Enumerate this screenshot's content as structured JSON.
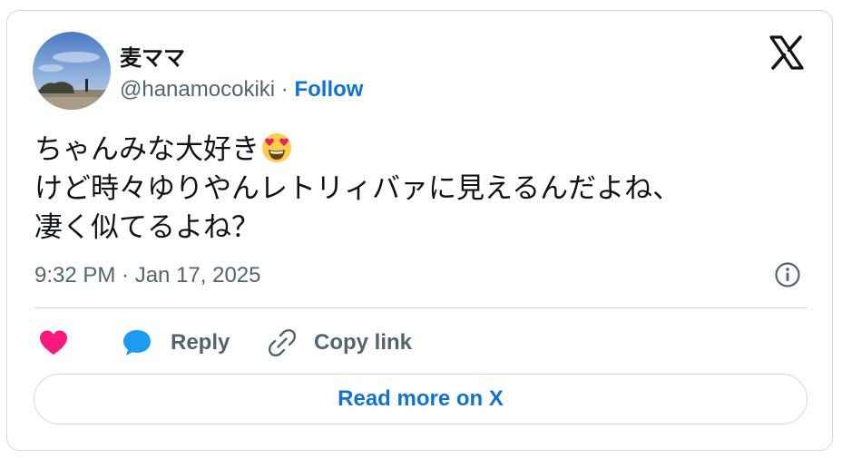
{
  "tweet": {
    "author_name": "麦ママ",
    "handle": "@hanamocokiki",
    "separator": "·",
    "follow_label": "Follow",
    "text_lines": [
      "ちゃんみな大好き",
      "けど時々ゆりやんレトリィバァに見えるんだよね、",
      "凄く似てるよね？"
    ],
    "timestamp": "9:32 PM · Jan 17, 2025"
  },
  "actions": {
    "reply_label": "Reply",
    "copy_link_label": "Copy link",
    "read_more_label": "Read more on X"
  },
  "icons": {
    "platform_logo": "x-logo-icon",
    "emoji": "heart-eyes-emoji-icon",
    "like": "heart-icon",
    "reply": "speech-bubble-icon",
    "copy": "link-icon",
    "info": "info-icon"
  },
  "colors": {
    "link_blue": "#0f73d6",
    "heart_pink": "#f91880",
    "reply_blue": "#1d9bf0",
    "muted_text": "#536471",
    "border": "#cfd9de"
  }
}
